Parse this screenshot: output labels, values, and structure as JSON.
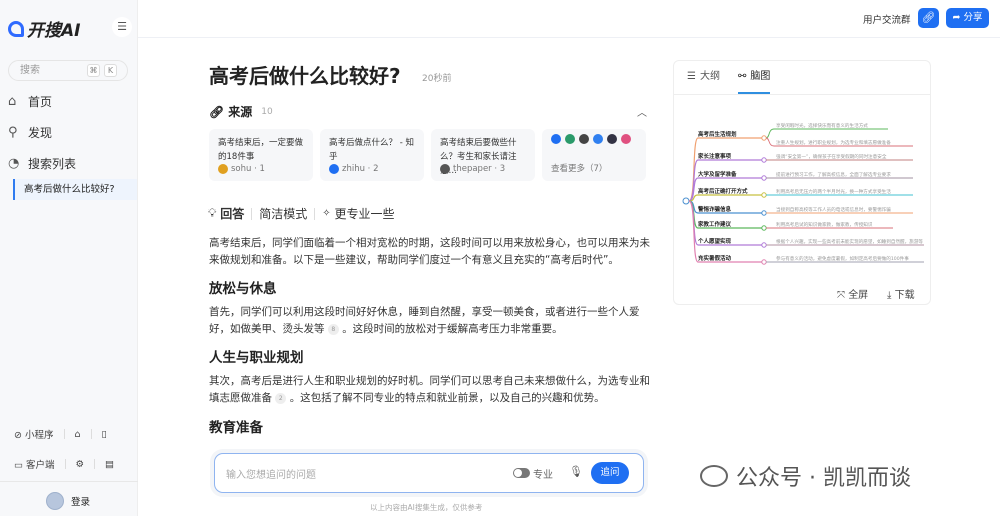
{
  "app": {
    "logo": "开搜AI"
  },
  "sidebar": {
    "search_placeholder": "搜索",
    "kbd1": "⌘",
    "kbd2": "K",
    "nav": [
      {
        "label": "首页",
        "icon": "home-icon"
      },
      {
        "label": "发现",
        "icon": "search-icon"
      },
      {
        "label": "搜索列表",
        "icon": "history-icon"
      }
    ],
    "history_item": "高考后做什么比较好?",
    "mini_program": "小程序",
    "client": "客户端",
    "login": "登录"
  },
  "header": {
    "community": "用户交流群",
    "share": "分享"
  },
  "main": {
    "title": "高考后做什么比较好?",
    "time": "20秒前",
    "sources_label": "来源",
    "sources_count": "10",
    "sources": [
      {
        "title": "高考结束后，一定要做的18件事",
        "site": "sohu · 1",
        "color": "#e0a020"
      },
      {
        "title": "高考后做点什么？ - 知乎",
        "site": "zhihu · 2",
        "color": "#1f6ff2"
      },
      {
        "title": "高考结束后要做些什么？考生和家长请注意…",
        "site": "thepaper · 3",
        "color": "#555"
      }
    ],
    "more": "查看更多（7）",
    "answer_label": "回答",
    "mode_concise": "简洁模式",
    "mode_pro": "更专业一些",
    "intro": "高考结束后，同学们面临着一个相对宽松的时期，这段时间可以用来放松身心，也可以用来为未来做规划和准备。以下是一些建议，帮助同学们度过一个有意义且充实的“高考后时代”。",
    "sections": [
      {
        "heading": "放松与休息",
        "text": "首先，同学们可以利用这段时间好好休息，睡到自然醒，享受一顿美食，或者进行一些个人爱好，如做美甲、烫头发等",
        "cite": "8",
        "tail": "。这段时间的放松对于缓解高考压力非常重要。"
      },
      {
        "heading": "人生与职业规划",
        "text": "其次，高考后是进行人生和职业规划的好时机。同学们可以思考自己未来想做什么，为选专业和填志愿做准备",
        "cite": "2",
        "tail": "。这包括了解不同专业的特点和就业前景，以及自己的兴趣和优势。"
      },
      {
        "heading": "教育准备",
        "text": "",
        "cite": "",
        "tail": ""
      }
    ],
    "input_placeholder": "输入您想追问的问题",
    "pro_toggle": "专业",
    "ask_button": "追问",
    "disclaimer": "以上内容由AI搜集生成，仅供参考"
  },
  "panel": {
    "tab_outline": "大纲",
    "tab_mindmap": "脑图",
    "fullscreen": "全屏",
    "download": "下载",
    "mindmap": [
      {
        "node": "高考后生活规划",
        "color": "#f0a070",
        "leaves": [
          "享受闲暇时光，选择快乐而有意义的生活方式",
          "注重人生规划，进行职业规划，为选专业和填志愿做准备"
        ],
        "leaf_colors": [
          "#5cb85c",
          "#d9707a"
        ]
      },
      {
        "node": "家长注意事项",
        "color": "#b07ad8",
        "leaves": [
          "强调“安全第一”，确保孩子在享受假期的同时注意安全"
        ],
        "leaf_colors": [
          "#c08080"
        ]
      },
      {
        "node": "大学及留学准备",
        "color": "#b07ad8",
        "leaves": [
          "提前进行预习工作，了解高校信息，全面了解选专业要求"
        ],
        "leaf_colors": [
          "#a090a0"
        ]
      },
      {
        "node": "高考后正确打开方式",
        "color": "#c8c040",
        "leaves": [
          "利用高考后无压力的两个半月时光，换一种方式享受生活"
        ],
        "leaf_colors": [
          "#40c0d0"
        ]
      },
      {
        "node": "警惕诈骗信息",
        "color": "#4a90d0",
        "leaves": [
          "当接到自称高校等工作人员的电话或信息时，要警惕诈骗"
        ],
        "leaf_colors": [
          "#f0a070"
        ]
      },
      {
        "node": "家教工作建议",
        "color": "#5cb85c",
        "leaves": [
          "利用高考后试的知识做家教，做家教，传授知识"
        ],
        "leaf_colors": [
          "#d9707a"
        ]
      },
      {
        "node": "个人愿望实现",
        "color": "#b07ad8",
        "leaves": [
          "根据个人兴趣，实现一些高考前未能实现的愿望，如睡到自然醒，旅游等"
        ],
        "leaf_colors": [
          "#b090a0"
        ]
      },
      {
        "node": "充实暑假活动",
        "color": "#e080b0",
        "leaves": [
          "参与有意义的活动，避免虚度暑假，如制定高考后要做的100件事"
        ],
        "leaf_colors": [
          "#a0a0b0"
        ]
      }
    ]
  },
  "watermark": "公众号 · 凯凯而谈"
}
